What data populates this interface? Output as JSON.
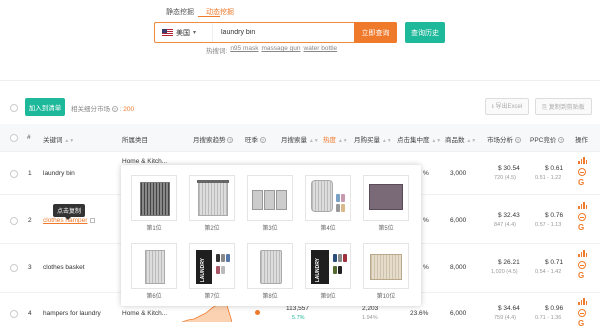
{
  "tabs": [
    "静态挖掘",
    "动态挖掘"
  ],
  "search": {
    "country": "美国",
    "value": "laundry bin",
    "button": "立即查询",
    "history_button": "查询历史"
  },
  "hot_words": {
    "label": "热搜词:",
    "words": [
      "n95 mask",
      "massage gun",
      "water bottle"
    ]
  },
  "toolbar": {
    "add_list": "加入到清单",
    "market_label": "相关细分市场",
    "market_count": "200",
    "export": "导出Excel",
    "copy": "复制到剪贴板"
  },
  "columns": [
    "#",
    "关键词",
    "所属类目",
    "月搜索趋势",
    "旺季",
    "月搜索量",
    "热度",
    "月购买量",
    "点击集中度",
    "商品数",
    "市场分析",
    "PPC竞价",
    "操作"
  ],
  "rows": [
    {
      "num": "1",
      "keyword": "laundry bin",
      "category": "Home & Kitch...",
      "products": "3,000",
      "analysis": "$ 30.54",
      "analysis_sub": "720 (4.5)",
      "ppc": "$ 0.61",
      "ppc_sub": "0.51 - 1.22"
    },
    {
      "num": "2",
      "keyword": "clothes hamper",
      "category": "",
      "products": "6,000",
      "analysis": "$ 32.43",
      "analysis_sub": "847 (4.4)",
      "ppc": "$ 0.76",
      "ppc_sub": "0.57 - 1.13"
    },
    {
      "num": "3",
      "keyword": "clothes basket",
      "category": "",
      "products": "8,000",
      "analysis": "$ 26.21",
      "analysis_sub": "1,020 (4.5)",
      "ppc": "$ 0.71",
      "ppc_sub": "0.54 - 1.42"
    },
    {
      "num": "4",
      "keyword": "hampers for laundry",
      "category": "Home & Kitch...",
      "searches": "113,557",
      "searches_sub": "5.7%",
      "purchases": "2,203",
      "purchases_sub": "1.94%",
      "click": "23.6%",
      "products": "6,000",
      "analysis": "$ 34.64",
      "analysis_sub": "759 (4.4)",
      "ppc": "$ 0.96",
      "ppc_sub": "0.71 - 1.36"
    }
  ],
  "partial_values": [
    "%",
    "%",
    "%"
  ],
  "tooltip": "点击复制",
  "popup": {
    "items": [
      {
        "label": "第1位",
        "icon": "mesh-hamper-image"
      },
      {
        "label": "第2位",
        "icon": "grey-hamper-image"
      },
      {
        "label": "第3位",
        "icon": "sorter-image"
      },
      {
        "label": "第4位",
        "icon": "round-hamper-image"
      },
      {
        "label": "第5位",
        "icon": "purple-basket-image"
      },
      {
        "label": "第6位",
        "icon": "tall-hamper-image"
      },
      {
        "label": "第7位",
        "icon": "black-laundry-bag-image"
      },
      {
        "label": "第8位",
        "icon": "grey-bag-image"
      },
      {
        "label": "第9位",
        "icon": "black-laundry-hamper-image"
      },
      {
        "label": "第10位",
        "icon": "woven-basket-image"
      }
    ]
  },
  "colors": {
    "accent": "#f07a2b",
    "green": "#1eb89a"
  }
}
